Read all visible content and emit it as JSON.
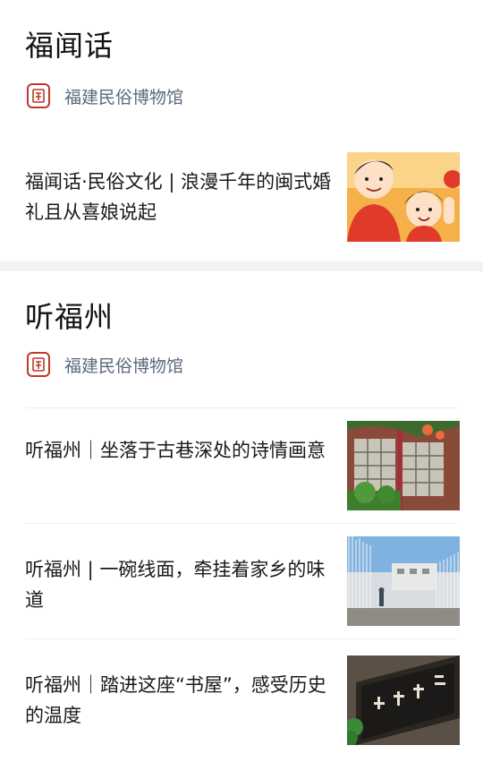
{
  "sections": [
    {
      "title": "福闻话",
      "source": {
        "name": "福建民俗博物馆",
        "icon": "museum-seal-icon"
      },
      "articles": [
        {
          "title": "福闻话·民俗文化 | 浪漫千年的闽式婚礼且从喜娘说起",
          "thumbnail": "cartoon-bride-illustration"
        }
      ]
    },
    {
      "title": "听福州",
      "source": {
        "name": "福建民俗博物馆",
        "icon": "museum-seal-icon"
      },
      "articles": [
        {
          "title": "听福州｜坐落于古巷深处的诗情画意",
          "thumbnail": "lattice-window-photo"
        },
        {
          "title": "听福州 | 一碗线面，牵挂着家乡的味道",
          "thumbnail": "noodle-drying-photo"
        },
        {
          "title": "听福州｜踏进这座“书屋”，感受历史的温度",
          "thumbnail": "calligraphy-plaque-photo"
        }
      ]
    }
  ],
  "colors": {
    "background": "#f2f2f2",
    "card": "#ffffff",
    "source_text": "#5a6a7c",
    "seal_red": "#c0392b"
  }
}
